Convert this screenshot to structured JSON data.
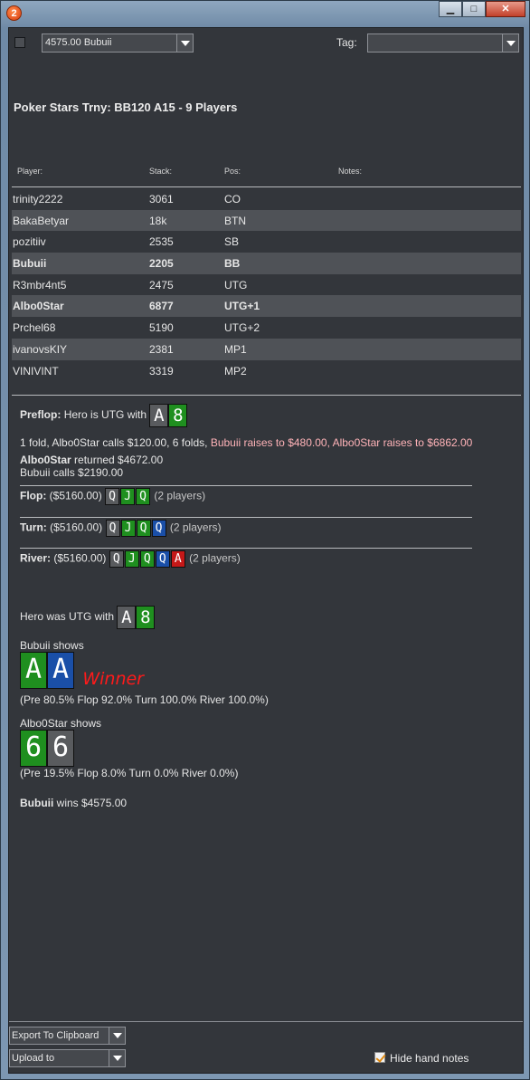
{
  "window": {
    "app_icon": "2",
    "controls": [
      "minimize",
      "maximize",
      "close"
    ]
  },
  "toolbar": {
    "hand_select": "4575.00 Bubuii",
    "tag_label": "Tag:",
    "tag_value": ""
  },
  "hand": {
    "title": "Poker Stars Trny: BB120 A15 - 9 Players",
    "headers": {
      "player": "Player:",
      "stack": "Stack:",
      "pos": "Pos:",
      "notes": "Notes:"
    },
    "players": [
      {
        "name": "trinity2222",
        "stack": "3061",
        "pos": "CO"
      },
      {
        "name": "BakaBetyar",
        "stack": "18k",
        "pos": "BTN"
      },
      {
        "name": "pozitiiv",
        "stack": "2535",
        "pos": "SB"
      },
      {
        "name": "Bubuii",
        "stack": "2205",
        "pos": "BB"
      },
      {
        "name": "R3mbr4nt5",
        "stack": "2475",
        "pos": "UTG"
      },
      {
        "name": "Albo0Star",
        "stack": "6877",
        "pos": "UTG+1"
      },
      {
        "name": "Prchel68",
        "stack": "5190",
        "pos": "UTG+2"
      },
      {
        "name": "ivanovsKIY",
        "stack": "2381",
        "pos": "MP1"
      },
      {
        "name": "VINIVINT",
        "stack": "3319",
        "pos": "MP2"
      }
    ]
  },
  "history": {
    "preflop_label": "Preflop:",
    "preflop_intro": "Hero is UTG with",
    "hero_cards": [
      "A",
      "8"
    ],
    "action_plain": "1 fold, Albo0Star calls $120.00, 6 folds,",
    "action_raise1": "Bubuii raises to $480.00,",
    "action_raise2": "Albo0Star raises to $6862.00",
    "returned_name": "Albo0Star",
    "returned_text": "returned $4672.00",
    "calls_line": "Bubuii calls $2190.00",
    "flop_label": "Flop:",
    "flop_pot": "($5160.00)",
    "flop_cards": [
      "Q",
      "J",
      "Q"
    ],
    "flop_players": "(2 players)",
    "turn_label": "Turn:",
    "turn_pot": "($5160.00)",
    "turn_cards": [
      "Q",
      "J",
      "Q",
      "Q"
    ],
    "turn_players": "(2 players)",
    "river_label": "River:",
    "river_pot": "($5160.00)",
    "river_cards": [
      "Q",
      "J",
      "Q",
      "Q",
      "A"
    ],
    "river_players": "(2 players)",
    "hero_was": "Hero was UTG with",
    "showdown1": "Bubuii shows",
    "showdown1_cards": [
      "A",
      "A"
    ],
    "winner_label": "Winner",
    "equity1": "(Pre 80.5% Flop 92.0% Turn 100.0% River 100.0%)",
    "showdown2": "Albo0Star shows",
    "showdown2_cards": [
      "6",
      "6"
    ],
    "equity2": "(Pre 19.5% Flop 8.0% Turn 0.0% River 0.0%)",
    "result_name": "Bubuii",
    "result_text": "wins $4575.00"
  },
  "footer": {
    "export_label": "Export To Clipboard",
    "upload_label": "Upload to",
    "hide_notes_label": "Hide hand notes",
    "hide_notes_checked": true
  },
  "colors": {
    "card_gray": "#595b5e",
    "card_green": "#1f8f1f",
    "card_blue": "#1a4fa8",
    "card_red": "#c41818",
    "raise_text": "#ffb3b8",
    "winner_text": "#ff1a1a"
  }
}
